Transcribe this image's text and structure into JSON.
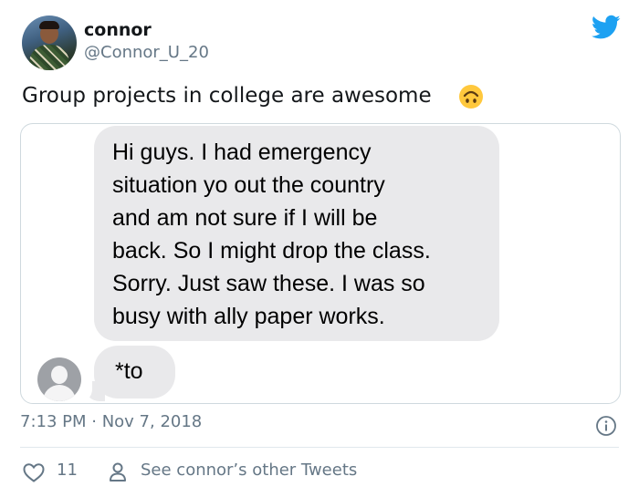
{
  "tweet": {
    "author_name": "connor",
    "author_handle": "@Connor_U_20",
    "text": "Group projects in college are awesome",
    "emoji": "upside-down-face-emoji",
    "timestamp": "7:13 PM · Nov 7, 2018",
    "like_count": "11",
    "other_tweets_label": "See connor’s other Tweets"
  },
  "media": {
    "messages": [
      {
        "lines": [
          "Hi guys.  I had emergency",
          "situation yo out the country",
          "and am not sure if I will be",
          "back. So I might drop the class.",
          "Sorry. Just saw these. I was so",
          "busy with ally paper works."
        ]
      },
      {
        "lines": [
          "*to"
        ]
      }
    ]
  },
  "icons": {
    "brand": "twitter-bird-icon",
    "info": "info-icon",
    "like": "heart-icon",
    "profile": "person-icon"
  },
  "colors": {
    "twitter_blue": "#1da1f2",
    "secondary_text": "#657786",
    "bubble_gray": "#e9e9eb",
    "emoji_yellow": "#ffc83d"
  }
}
